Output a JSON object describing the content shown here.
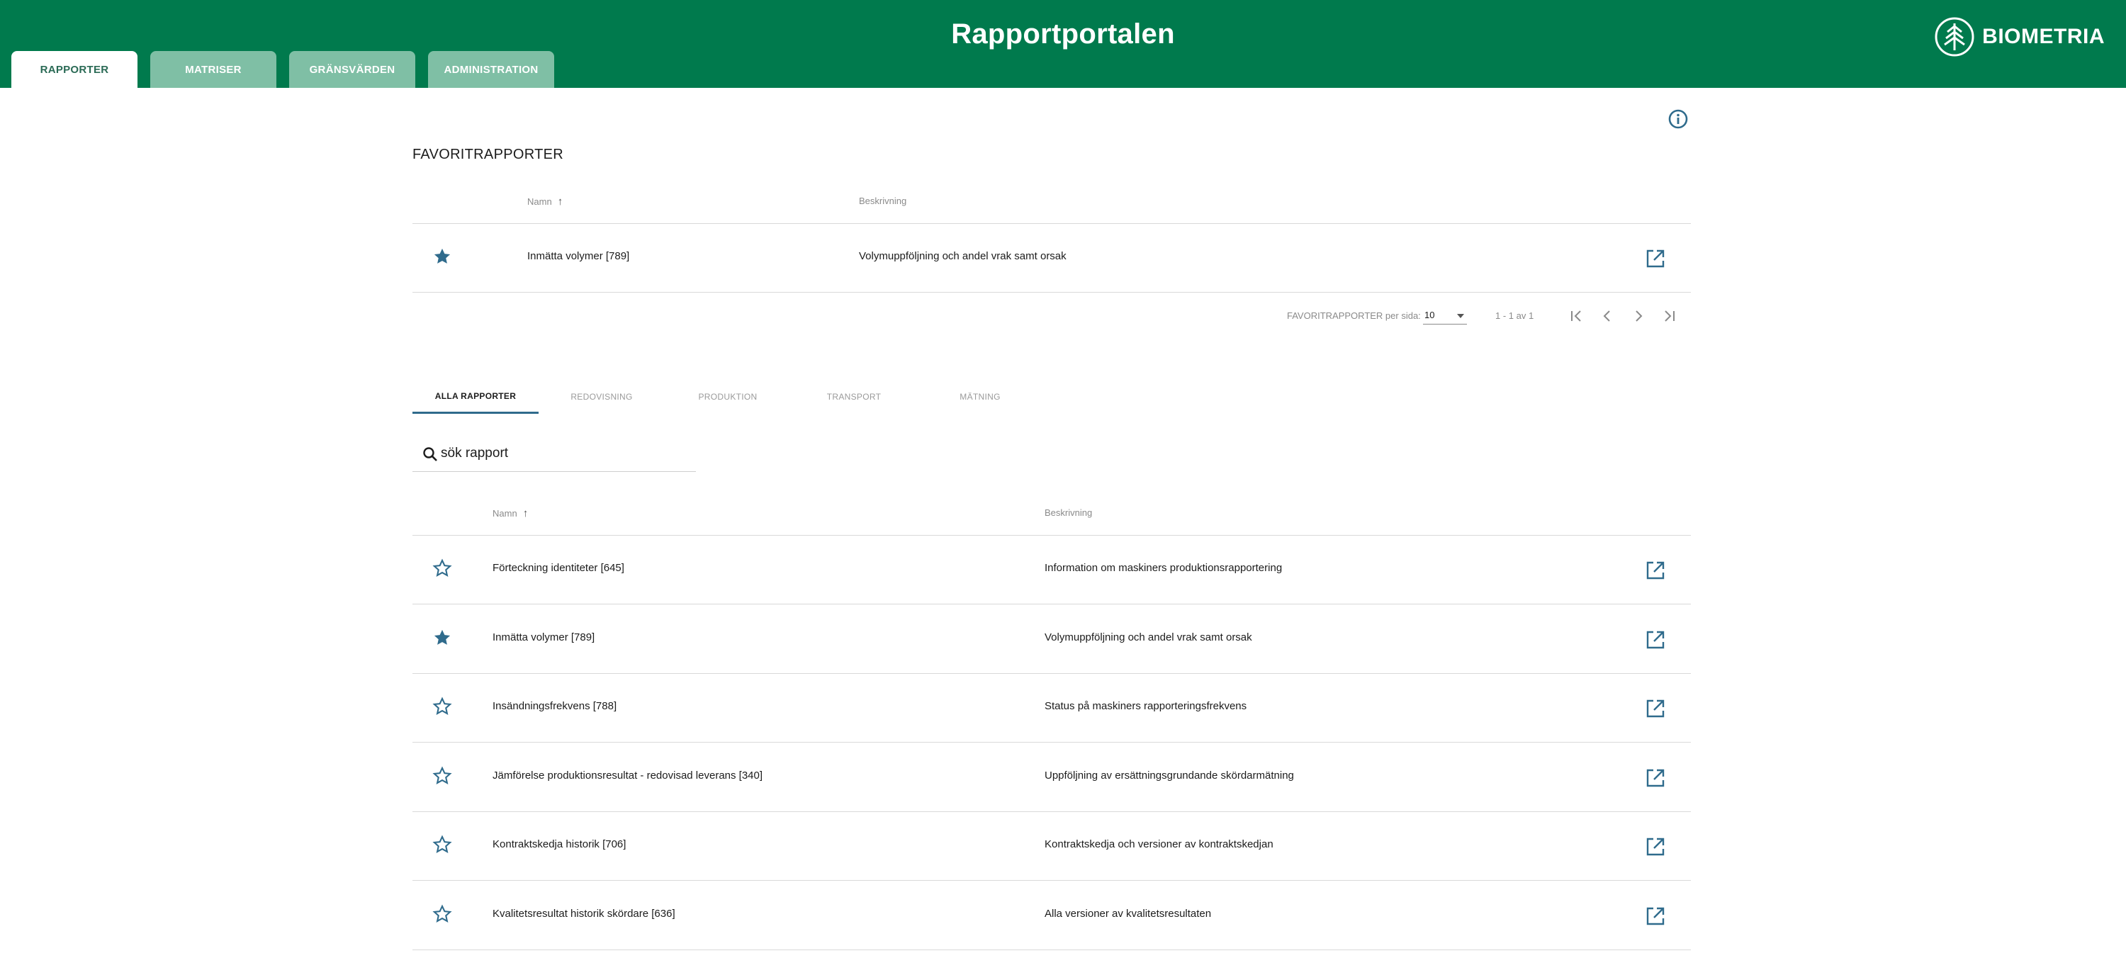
{
  "header": {
    "title": "Rapportportalen",
    "logo_text": "BIOMETRIA",
    "tabs": [
      {
        "label": "RAPPORTER",
        "active": true
      },
      {
        "label": "MATRISER",
        "active": false
      },
      {
        "label": "GRÄNSVÄRDEN",
        "active": false
      },
      {
        "label": "ADMINISTRATION",
        "active": false
      }
    ]
  },
  "favorites": {
    "title": "FAVORITRAPPORTER",
    "columns": {
      "name": "Namn",
      "description": "Beskrivning"
    },
    "rows": [
      {
        "favorite": true,
        "name": "Inmätta volymer [789]",
        "description": "Volymuppföljning och andel vrak samt orsak"
      }
    ],
    "pager": {
      "per_page_label": "FAVORITRAPPORTER per sida:",
      "per_page_value": "10",
      "range": "1 - 1 av 1"
    }
  },
  "report_tabs": [
    {
      "label": "ALLA RAPPORTER",
      "active": true
    },
    {
      "label": "REDOVISNING",
      "active": false
    },
    {
      "label": "PRODUKTION",
      "active": false
    },
    {
      "label": "TRANSPORT",
      "active": false
    },
    {
      "label": "MÄTNING",
      "active": false
    }
  ],
  "search": {
    "value": "sök rapport"
  },
  "reports": {
    "columns": {
      "name": "Namn",
      "description": "Beskrivning"
    },
    "rows": [
      {
        "favorite": false,
        "name": "Förteckning identiteter [645]",
        "description": "Information om maskiners produktionsrapportering"
      },
      {
        "favorite": true,
        "name": "Inmätta volymer [789]",
        "description": "Volymuppföljning och andel vrak samt orsak"
      },
      {
        "favorite": false,
        "name": "Insändningsfrekvens [788]",
        "description": "Status på maskiners rapporteringsfrekvens"
      },
      {
        "favorite": false,
        "name": "Jämförelse produktionsresultat - redovisad leverans [340]",
        "description": "Uppföljning av ersättningsgrundande skördarmätning"
      },
      {
        "favorite": false,
        "name": "Kontraktskedja historik [706]",
        "description": "Kontraktskedja och versioner av kontraktskedjan"
      },
      {
        "favorite": false,
        "name": "Kvalitetsresultat historik skördare [636]",
        "description": "Alla versioner av kvalitetsresultaten"
      }
    ]
  },
  "colors": {
    "brand": "#007a4d",
    "tab_inactive": "#7fbfa5",
    "icon": "#2f6b8c"
  }
}
